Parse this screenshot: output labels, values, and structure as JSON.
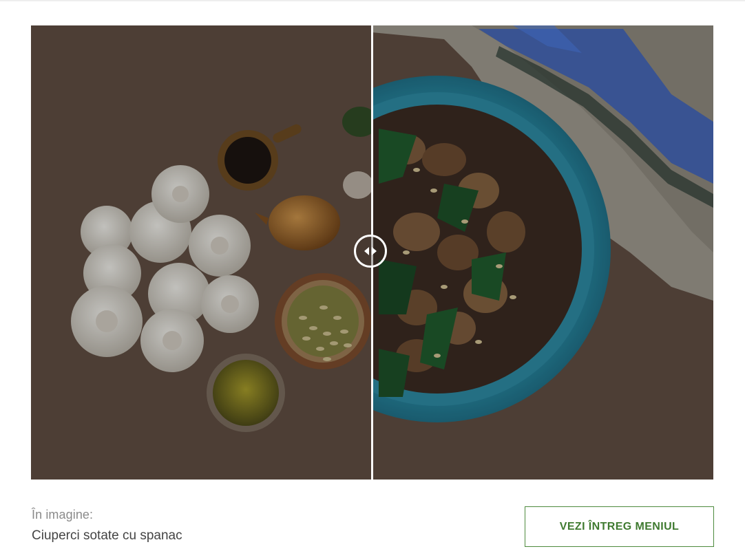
{
  "comparison": {
    "left_image": "raw-ingredients-mushrooms-onion-pumpkin-seeds-oil",
    "right_image": "sauteed-mushrooms-with-spinach-in-turquoise-bowl",
    "handle_icon": "left-right-arrows-icon",
    "slider_position": 0.5
  },
  "caption": {
    "label": "În imagine:",
    "title": "Ciuperci sotate cu spanac"
  },
  "menu_button": {
    "label": "VEZI ÎNTREG MENIUL"
  },
  "colors": {
    "accent_green": "#3f7a30",
    "bowl_turquoise": "#2f95ad",
    "background_brown": "#5a4a3f"
  }
}
